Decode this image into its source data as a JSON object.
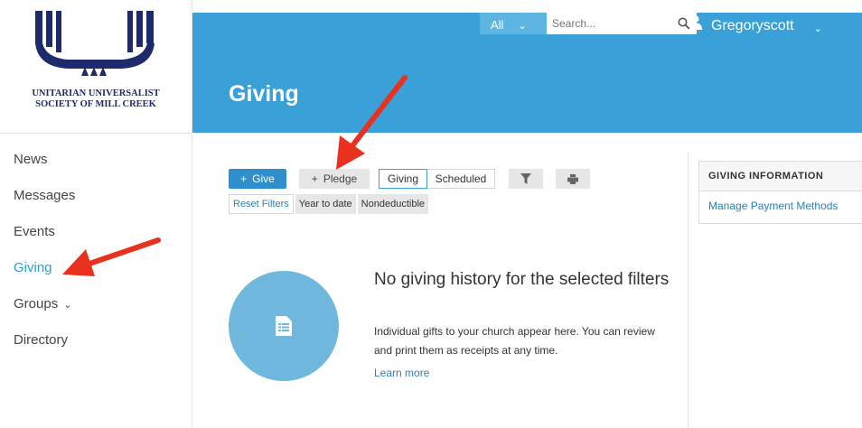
{
  "org": {
    "line1": "UNITARIAN UNIVERSALIST",
    "line2": "SOCIETY OF MILL CREEK"
  },
  "sidebar": {
    "items": [
      {
        "label": "News"
      },
      {
        "label": "Messages"
      },
      {
        "label": "Events"
      },
      {
        "label": "Giving",
        "active": true
      },
      {
        "label": "Groups",
        "has_submenu": true
      },
      {
        "label": "Directory"
      }
    ]
  },
  "header": {
    "search_scope": "All",
    "search_placeholder": "Search...",
    "user_name": "Gregoryscott"
  },
  "page": {
    "title": "Giving"
  },
  "toolbar": {
    "give_label": "Give",
    "pledge_label": "Pledge",
    "view_tabs": [
      "Giving",
      "Scheduled"
    ],
    "active_tab": "Giving"
  },
  "filters": {
    "reset_label": "Reset Filters",
    "chips": [
      "Year to date",
      "Nondeductible"
    ]
  },
  "empty_state": {
    "title": "No giving history for the selected filters",
    "body": "Individual gifts to your church appear here. You can review and print them as receipts at any time.",
    "link": "Learn more"
  },
  "info_panel": {
    "heading": "GIVING INFORMATION",
    "link": "Manage Payment Methods"
  },
  "colors": {
    "banner": "#3aa1d8",
    "primary_button": "#2f8fcd",
    "link": "#2a7fc0",
    "active_nav": "#2a9fd6",
    "annotation_arrow": "#e8311f",
    "logo_navy": "#1d2a6b"
  },
  "icons": {
    "search": "search-icon",
    "user": "user-icon",
    "filter": "filter-icon",
    "print": "print-icon",
    "document": "document-icon"
  }
}
